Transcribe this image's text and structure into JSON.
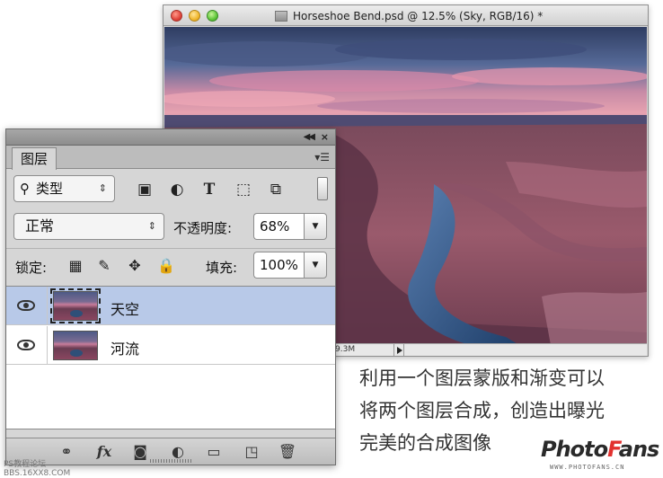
{
  "document": {
    "title": "Horseshoe Bend.psd @ 12.5% (Sky, RGB/16) *",
    "status_size": "9.3M"
  },
  "layers_panel": {
    "collapse_icon": "double-chevron-icon",
    "close_icon": "close-icon",
    "tab_label": "图层",
    "filter": {
      "icon": "search-icon",
      "label": "类型"
    },
    "filter_icons": [
      "image-filter-icon",
      "adjustment-filter-icon",
      "type-filter-icon",
      "shape-filter-icon",
      "smart-object-filter-icon"
    ],
    "blend_mode": "正常",
    "opacity_label": "不透明度:",
    "opacity_value": "68%",
    "lock_label": "锁定:",
    "lock_icons": [
      "lock-transparent-icon",
      "lock-image-icon",
      "lock-position-icon",
      "lock-all-icon"
    ],
    "fill_label": "填充:",
    "fill_value": "100%",
    "layers": [
      {
        "name": "天空",
        "visible": true,
        "selected": true
      },
      {
        "name": "河流",
        "visible": true,
        "selected": false
      }
    ],
    "bottom_icons": [
      "link-icon",
      "fx-icon",
      "mask-icon",
      "adjustment-layer-icon",
      "folder-icon",
      "new-layer-icon",
      "trash-icon"
    ],
    "fx_text": "fx"
  },
  "caption": {
    "line1": "利用一个图层蒙版和渐变可以",
    "line2": "将两个图层合成，创造出曝光",
    "line3": "完美的合成图像"
  },
  "branding": {
    "photo": "Photo",
    "f": "F",
    "ans": "ans",
    "url": "WWW.PHOTOFANS.CN"
  },
  "watermark": {
    "line1": "PS教程论坛",
    "line2": "BBS.16XX8.COM"
  },
  "colors": {
    "selection": "#b8c9e8",
    "brand_accent": "#e2312f"
  }
}
